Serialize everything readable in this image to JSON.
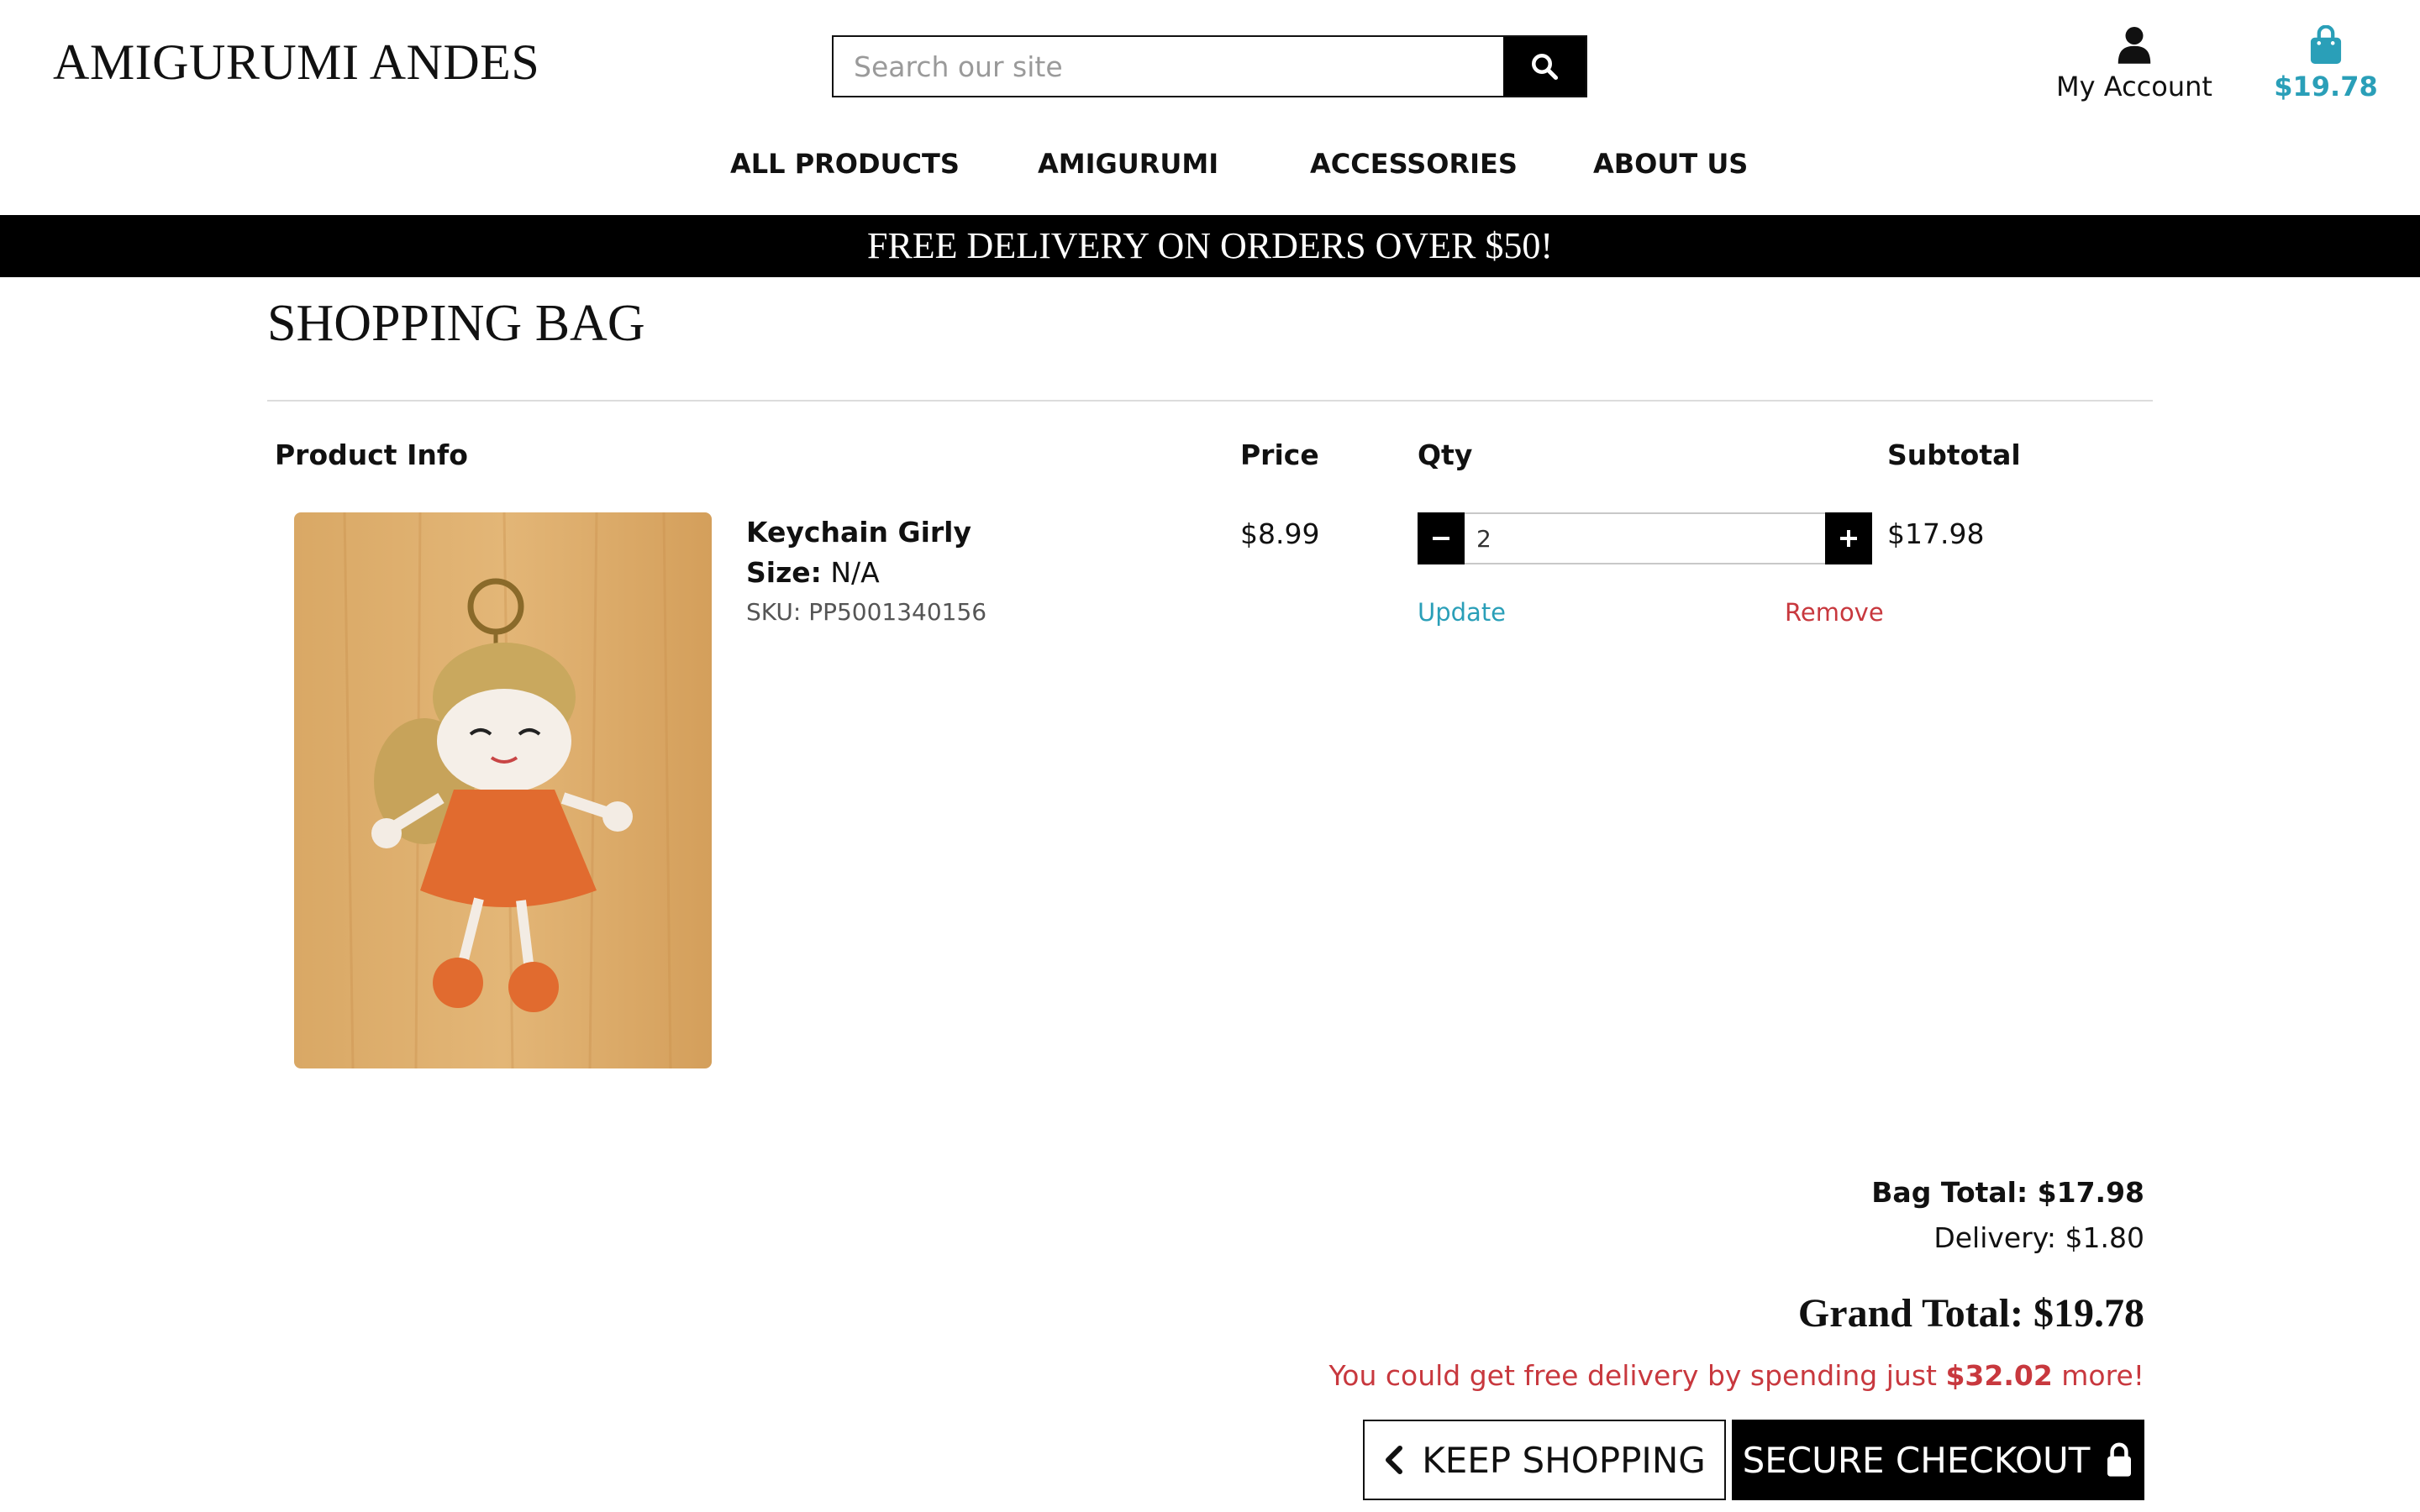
{
  "header": {
    "brand": "AMIGURUMI ANDES",
    "search": {
      "placeholder": "Search our site",
      "value": ""
    },
    "account_label": "My Account",
    "bag_total": "$19.78",
    "accent_color": "#2a9fb8",
    "danger_color": "#c8383e"
  },
  "nav": {
    "items": [
      {
        "label": "ALL PRODUCTS"
      },
      {
        "label": "AMIGURUMI"
      },
      {
        "label": "ACCESSORIES"
      },
      {
        "label": "ABOUT US"
      }
    ]
  },
  "banner": {
    "text": "FREE DELIVERY ON ORDERS OVER $50!"
  },
  "page": {
    "title": "SHOPPING BAG"
  },
  "table": {
    "headers": {
      "product_info": "Product Info",
      "price": "Price",
      "qty": "Qty",
      "subtotal": "Subtotal"
    },
    "rows": [
      {
        "name": "Keychain Girly",
        "size_label": "Size:",
        "size_value": "N/A",
        "sku": "SKU: PP5001340156",
        "price": "$8.99",
        "qty": "2",
        "subtotal": "$17.98",
        "update_label": "Update",
        "remove_label": "Remove",
        "image_icon": "crochet-doll-keychain-photo"
      }
    ]
  },
  "summary": {
    "bag_total": "Bag Total: $17.98",
    "delivery": "Delivery: $1.80",
    "grand_total": "Grand Total: $19.78",
    "free_msg_prefix": "You could get free delivery by spending just ",
    "free_msg_amount": "$32.02",
    "free_msg_suffix": " more!"
  },
  "buttons": {
    "keep_shopping": "KEEP SHOPPING",
    "secure_checkout": "SECURE CHECKOUT"
  }
}
